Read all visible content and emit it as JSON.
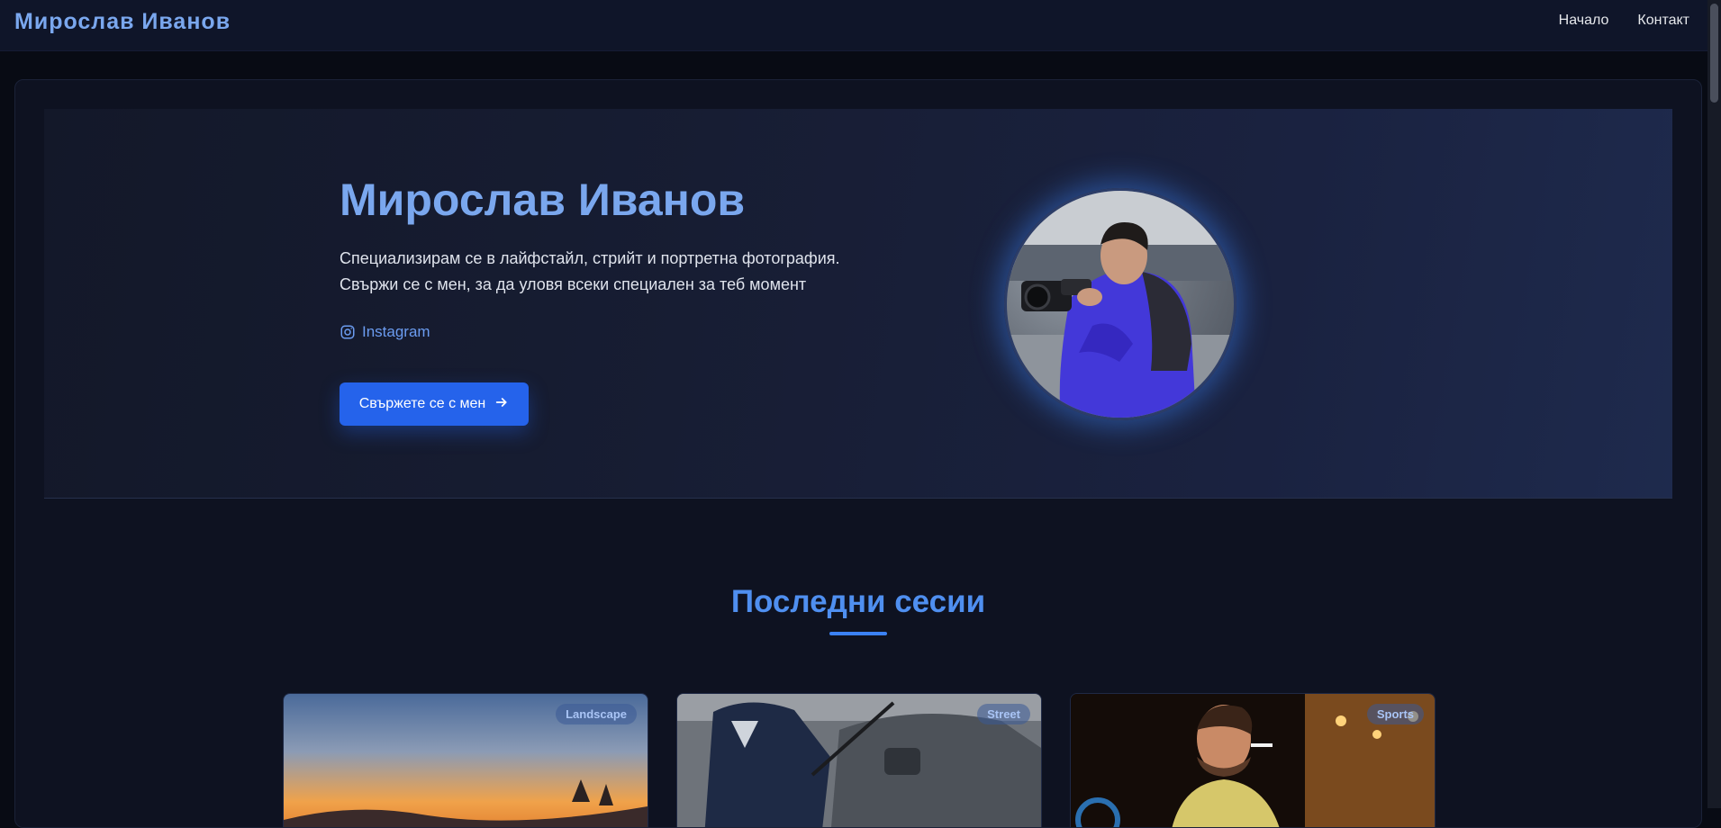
{
  "header": {
    "brand": "Мирослав Иванов",
    "nav": [
      {
        "label": "Начало"
      },
      {
        "label": "Контакт"
      }
    ]
  },
  "hero": {
    "title": "Мирослав Иванов",
    "description_line1": "Специализирам се в лайфстайл, стрийт и портретна фотография.",
    "description_line2": "Свържи се с мен, за да уловя всеки специален за теб момент",
    "instagram_label": "Instagram",
    "cta_label": "Свържете се с мен",
    "avatar_icon": "photographer-portrait"
  },
  "sessions": {
    "title": "Последни сесии",
    "items": [
      {
        "tag": "Landscape"
      },
      {
        "tag": "Street"
      },
      {
        "tag": "Sports"
      }
    ]
  },
  "colors": {
    "accent": "#3b82f6",
    "button": "#2563eb",
    "brand_text": "#7aa7ee",
    "background": "#080b14"
  }
}
